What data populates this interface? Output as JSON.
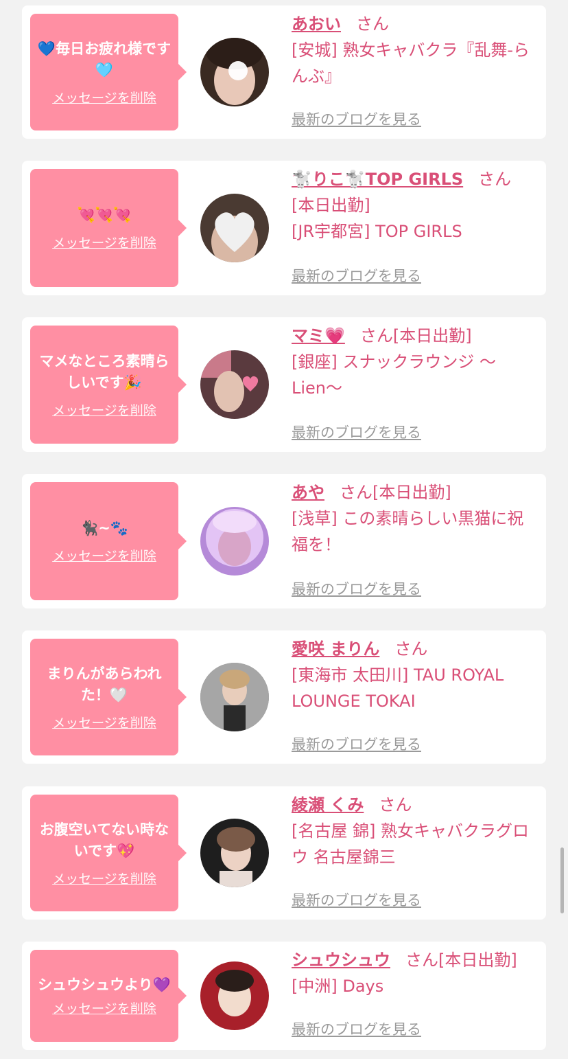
{
  "colors": {
    "accent": "#d94f77",
    "bubble": "#ff8fa3",
    "link_gray": "#9a9a9a",
    "background": "#f2f2f2"
  },
  "delete_label": "メッセージを削除",
  "blog_label": "最新のブログを見る",
  "honorific": "さん",
  "cards": [
    {
      "message": "💙毎日お疲れ様です🩵",
      "name": "あおい",
      "today_tag": "",
      "shop": "[安城] 熟女キャバクラ『乱舞-らんぶ』"
    },
    {
      "message": "💘💘💘",
      "name": "🐩りこ🐩TOP GIRLS",
      "today_tag": "",
      "extra": "[本日出勤]",
      "shop": "[JR宇都宮] TOP GIRLS"
    },
    {
      "message": "マメなところ素晴らしいです🎉",
      "name": "マミ💗",
      "today_tag": "[本日出勤]",
      "shop": "[銀座] スナックラウンジ 〜Lien〜"
    },
    {
      "message": "🐈‍⬛~🐾",
      "name": "あや",
      "today_tag": "[本日出勤]",
      "shop": "[浅草] この素晴らしい黒猫に祝福を！"
    },
    {
      "message": "まりんがあらわれた！🤍",
      "name": "愛咲 まりん",
      "today_tag": "",
      "shop": "[東海市 太田川] TAU ROYAL LOUNGE TOKAI"
    },
    {
      "message": "お腹空いてない時ないです💖",
      "name": "綾瀬 くみ",
      "today_tag": "",
      "shop": "[名古屋 錦] 熟女キャバクラグロウ 名古屋錦三"
    },
    {
      "message": "シュウシュウより💜",
      "name": "シュウシュウ",
      "today_tag": "[本日出勤]",
      "shop": "[中洲] Days"
    }
  ]
}
